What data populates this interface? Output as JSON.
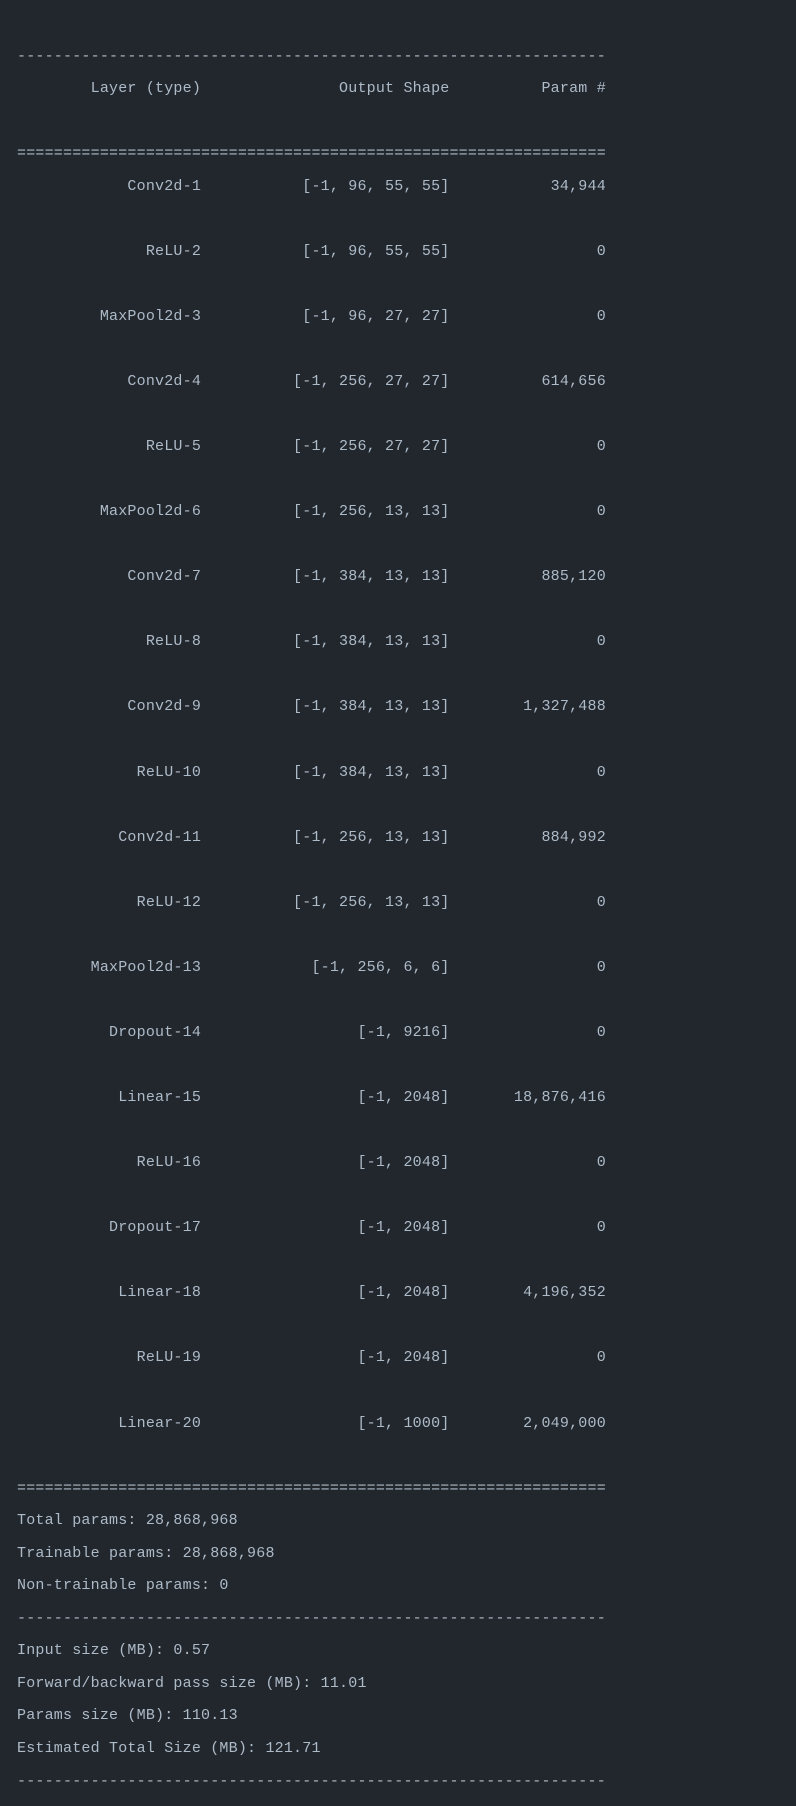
{
  "divider_dash": "----------------------------------------------------------------",
  "divider_eq": "================================================================",
  "headers": {
    "layer": "Layer (type)",
    "output_shape": "Output Shape",
    "params": "Param #"
  },
  "rows": [
    {
      "layer": "Conv2d-1",
      "shape": "[-1, 96, 55, 55]",
      "params": "34,944"
    },
    {
      "layer": "ReLU-2",
      "shape": "[-1, 96, 55, 55]",
      "params": "0"
    },
    {
      "layer": "MaxPool2d-3",
      "shape": "[-1, 96, 27, 27]",
      "params": "0"
    },
    {
      "layer": "Conv2d-4",
      "shape": "[-1, 256, 27, 27]",
      "params": "614,656"
    },
    {
      "layer": "ReLU-5",
      "shape": "[-1, 256, 27, 27]",
      "params": "0"
    },
    {
      "layer": "MaxPool2d-6",
      "shape": "[-1, 256, 13, 13]",
      "params": "0"
    },
    {
      "layer": "Conv2d-7",
      "shape": "[-1, 384, 13, 13]",
      "params": "885,120"
    },
    {
      "layer": "ReLU-8",
      "shape": "[-1, 384, 13, 13]",
      "params": "0"
    },
    {
      "layer": "Conv2d-9",
      "shape": "[-1, 384, 13, 13]",
      "params": "1,327,488"
    },
    {
      "layer": "ReLU-10",
      "shape": "[-1, 384, 13, 13]",
      "params": "0"
    },
    {
      "layer": "Conv2d-11",
      "shape": "[-1, 256, 13, 13]",
      "params": "884,992"
    },
    {
      "layer": "ReLU-12",
      "shape": "[-1, 256, 13, 13]",
      "params": "0"
    },
    {
      "layer": "MaxPool2d-13",
      "shape": "[-1, 256, 6, 6]",
      "params": "0"
    },
    {
      "layer": "Dropout-14",
      "shape": "[-1, 9216]",
      "params": "0"
    },
    {
      "layer": "Linear-15",
      "shape": "[-1, 2048]",
      "params": "18,876,416"
    },
    {
      "layer": "ReLU-16",
      "shape": "[-1, 2048]",
      "params": "0"
    },
    {
      "layer": "Dropout-17",
      "shape": "[-1, 2048]",
      "params": "0"
    },
    {
      "layer": "Linear-18",
      "shape": "[-1, 2048]",
      "params": "4,196,352"
    },
    {
      "layer": "ReLU-19",
      "shape": "[-1, 2048]",
      "params": "0"
    },
    {
      "layer": "Linear-20",
      "shape": "[-1, 1000]",
      "params": "2,049,000"
    }
  ],
  "summary": {
    "total_params": "Total params: 28,868,968",
    "trainable_params": "Trainable params: 28,868,968",
    "non_trainable_params": "Non-trainable params: 0",
    "input_size": "Input size (MB): 0.57",
    "fwd_bwd_size": "Forward/backward pass size (MB): 11.01",
    "params_size": "Params size (MB): 110.13",
    "est_total": "Estimated Total Size (MB): 121.71"
  }
}
